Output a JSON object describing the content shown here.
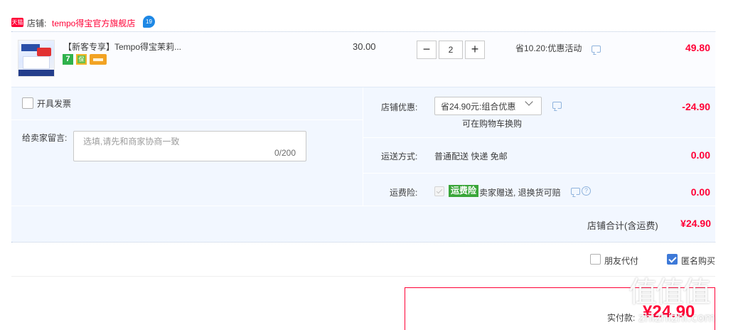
{
  "shop": {
    "badge": "天猫",
    "prefix": "店铺:",
    "name": "tempo得宝官方旗舰店",
    "wangwang_icon": "wangwang-chat-icon",
    "wangwang_badge": "19"
  },
  "item": {
    "title": "【新客专享】Tempo得宝茉莉...",
    "service_icons": [
      "seven-day-return-icon",
      "quality-guarantee-icon",
      "credit-card-installment-icon"
    ],
    "seven_day_label": "7",
    "shield_label": "保",
    "unit_price": "30.00",
    "quantity": "2",
    "minus_label": "−",
    "plus_label": "+",
    "promo": "省10.20:优惠活动",
    "subtotal": "49.80"
  },
  "invoice": {
    "label": "开具发票",
    "checked": false
  },
  "message": {
    "label": "给卖家留言:",
    "placeholder": "选填,请先和商家协商一致",
    "counter": "0/200"
  },
  "coupon": {
    "label": "店铺优惠:",
    "selected": "省24.90元:组合优惠",
    "note": "可在购物车换购",
    "amount": "-24.90"
  },
  "shipping": {
    "label": "运送方式:",
    "value": "普通配送 快递 免邮",
    "amount": "0.00"
  },
  "insurance": {
    "label": "运费险:",
    "badge": "运费险",
    "text": "卖家赠送, 退换货可赔",
    "help": "?",
    "amount": "0.00"
  },
  "shop_total": {
    "label": "店铺合计(含运费)",
    "amount": "¥24.90"
  },
  "options": {
    "friend_pay": "朋友代付",
    "friend_checked": false,
    "anonymous": "匿名购买",
    "anonymous_checked": true
  },
  "payment": {
    "label": "实付款:",
    "amount": "¥24.90"
  },
  "watermark": {
    "logo": "值值值",
    "text": "zhizhizhi.com"
  },
  "colors": {
    "accent_red": "#ff0036",
    "panel_blue": "#f2f7ff",
    "check_blue": "#3d79d8",
    "insurance_green": "#3aa63a"
  }
}
